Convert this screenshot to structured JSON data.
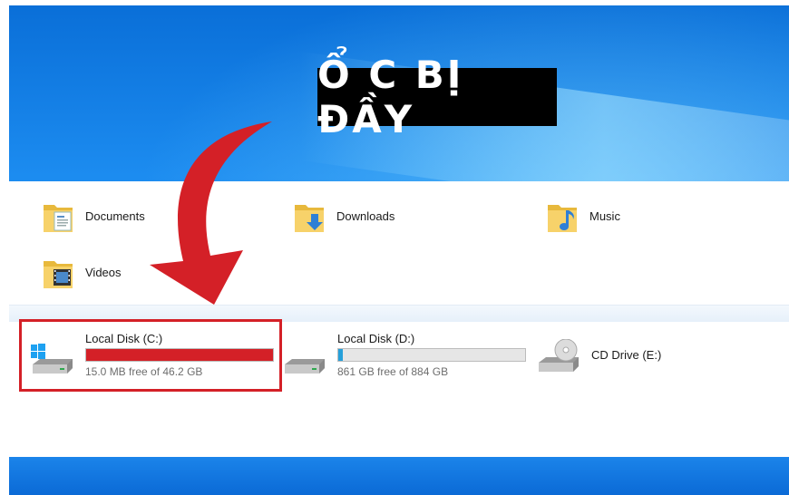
{
  "banner": {
    "title": "Ổ C BỊ ĐẦY"
  },
  "folders": [
    {
      "label": "Documents",
      "icon": "documents-folder-icon"
    },
    {
      "label": "Downloads",
      "icon": "downloads-folder-icon"
    },
    {
      "label": "Music",
      "icon": "music-folder-icon"
    },
    {
      "label": "Videos",
      "icon": "videos-folder-icon"
    }
  ],
  "drives": [
    {
      "name": "Local Disk (C:)",
      "free": "15.0 MB free of 46.2 GB",
      "used_fraction": 1.0,
      "bar_color": "#d42027",
      "icon": "windows-drive-icon"
    },
    {
      "name": "Local Disk (D:)",
      "free": "861 GB free of 884 GB",
      "used_fraction": 0.026,
      "bar_color": "#26a0da",
      "icon": "hard-drive-icon"
    },
    {
      "name": "CD Drive (E:)",
      "icon": "cd-drive-icon"
    }
  ],
  "colors": {
    "accent_red": "#d42027",
    "desktop_blue": "#0a6fd8"
  }
}
